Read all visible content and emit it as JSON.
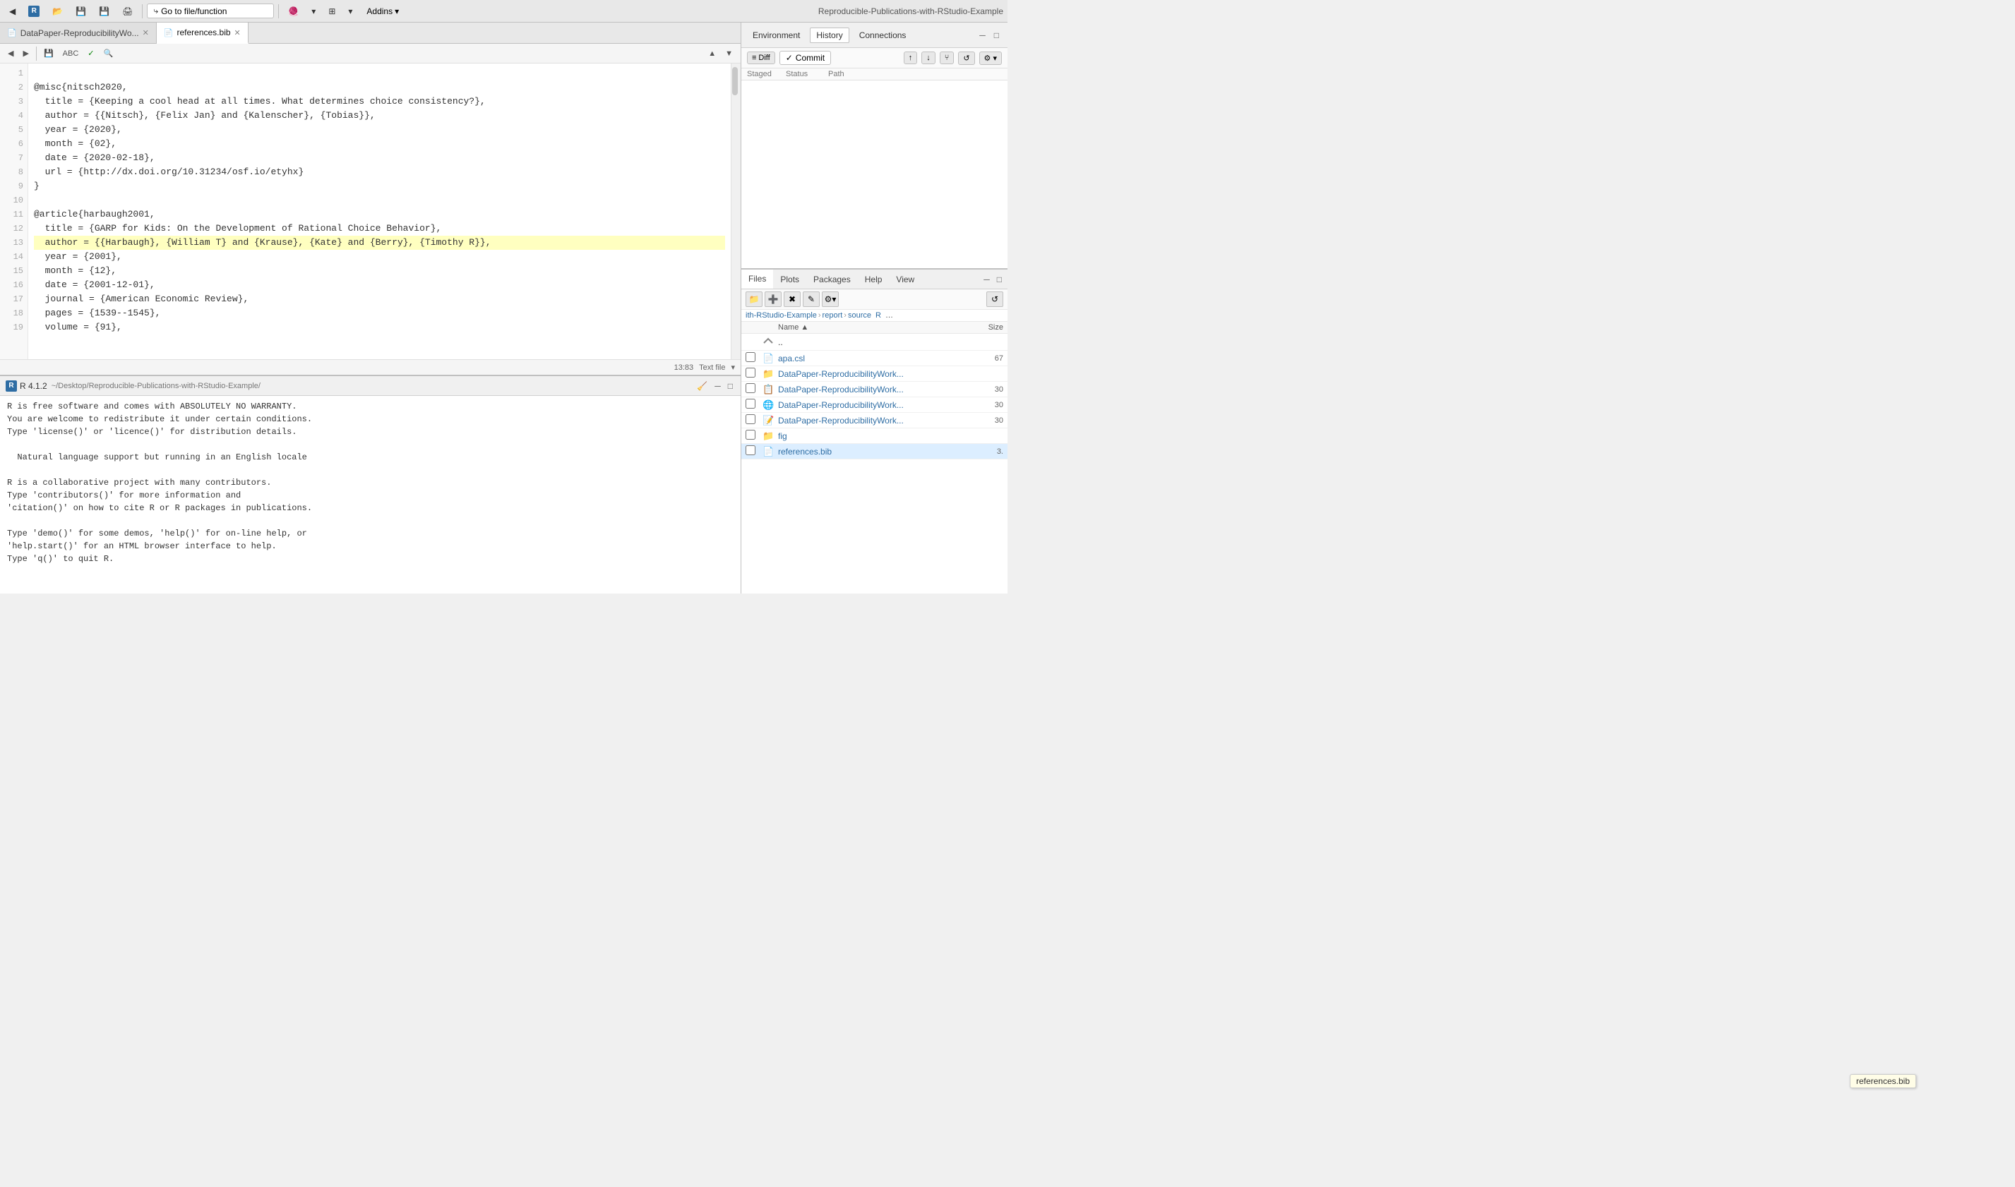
{
  "app": {
    "title": "Reproducible-Publications-with-RStudio-Example",
    "r_version": "R 4.1.2"
  },
  "toolbar": {
    "go_to_file": "Go to file/function",
    "addins": "Addins"
  },
  "editor": {
    "tabs": [
      {
        "label": "DataPaper-ReproducibilityWo...",
        "active": false,
        "icon": "📄",
        "closable": true
      },
      {
        "label": "references.bib",
        "active": true,
        "icon": "📄",
        "closable": true
      }
    ],
    "status": "13:83",
    "file_type": "Text file",
    "lines": [
      {
        "n": 1,
        "text": ""
      },
      {
        "n": 2,
        "text": "@misc{nitsch2020,"
      },
      {
        "n": 3,
        "text": "  title = {Keeping a cool head at all times. What determines choice consistency?},"
      },
      {
        "n": 4,
        "text": "  author = {{Nitsch}, {Felix Jan} and {Kalenscher}, {Tobias}},"
      },
      {
        "n": 5,
        "text": "  year = {2020},"
      },
      {
        "n": 6,
        "text": "  month = {02},"
      },
      {
        "n": 7,
        "text": "  date = {2020-02-18},"
      },
      {
        "n": 8,
        "text": "  url = {http://dx.doi.org/10.31234/osf.io/etyhx}"
      },
      {
        "n": 9,
        "text": "}"
      },
      {
        "n": 10,
        "text": ""
      },
      {
        "n": 11,
        "text": "@article{harbaugh2001,"
      },
      {
        "n": 12,
        "text": "  title = {GARP for Kids: On the Development of Rational Choice Behavior},"
      },
      {
        "n": 13,
        "text": "  author = {{Harbaugh}, {William T} and {Krause}, {Kate} and {Berry}, {Timothy R}},"
      },
      {
        "n": 14,
        "text": "  year = {2001},"
      },
      {
        "n": 15,
        "text": "  month = {12},"
      },
      {
        "n": 16,
        "text": "  date = {2001-12-01},"
      },
      {
        "n": 17,
        "text": "  journal = {American Economic Review},"
      },
      {
        "n": 18,
        "text": "  pages = {1539--1545},"
      },
      {
        "n": 19,
        "text": "  volume = {91},"
      }
    ]
  },
  "git_panel": {
    "tabs": [
      "Diff",
      "Commit",
      "History"
    ],
    "active_tab": "History",
    "columns": [
      "Staged",
      "Status",
      "Path"
    ],
    "controls": {
      "push": "↑",
      "pull": "↓",
      "more": "⚙"
    }
  },
  "console": {
    "title": "R 4.1.2",
    "path": "~/Desktop/Reproducible-Publications-with-RStudio-Example/",
    "lines": [
      "R is free software and comes with ABSOLUTELY NO WARRANTY.",
      "You are welcome to redistribute it under certain conditions.",
      "Type 'license()' or 'licence()' for distribution details.",
      "",
      "  Natural language support but running in an English locale",
      "",
      "R is a collaborative project with many contributors.",
      "Type 'contributors()' for more information and",
      "'citation()' on how to cite R or R packages in publications.",
      "",
      "Type 'demo()' for some demos, 'help()' for on-line help, or",
      "'help.start()' for an HTML browser interface to help.",
      "Type 'q()' to quit R."
    ]
  },
  "files_panel": {
    "tabs": [
      "Files",
      "Plots",
      "Packages",
      "Help",
      "View"
    ],
    "active_tab": "Files",
    "breadcrumb": [
      "ith-RStudio-Example",
      "report",
      "source"
    ],
    "header": {
      "name": "Name",
      "size": "Size"
    },
    "files": [
      {
        "name": "..",
        "type": "parent",
        "icon": "⬆",
        "size": "",
        "link": true
      },
      {
        "name": "apa.csl",
        "type": "file",
        "icon": "📄",
        "size": "67",
        "link": true
      },
      {
        "name": "DataPaper-ReproducibilityWork...",
        "type": "folder",
        "icon": "📁",
        "size": "",
        "link": true
      },
      {
        "name": "DataPaper-ReproducibilityWork...",
        "type": "file-rmd",
        "icon": "📋",
        "size": "30",
        "link": true
      },
      {
        "name": "DataPaper-ReproducibilityWork...",
        "type": "file-html",
        "icon": "🌐",
        "size": "30",
        "link": true
      },
      {
        "name": "DataPaper-ReproducibilityWork...",
        "type": "file-docx",
        "icon": "📝",
        "size": "30",
        "link": true
      },
      {
        "name": "fig",
        "type": "folder",
        "icon": "📁",
        "size": "",
        "link": true
      },
      {
        "name": "references.bib",
        "type": "file-bib",
        "icon": "📄",
        "size": "3.",
        "link": true,
        "selected": true
      }
    ],
    "tooltip": "references.bib"
  }
}
